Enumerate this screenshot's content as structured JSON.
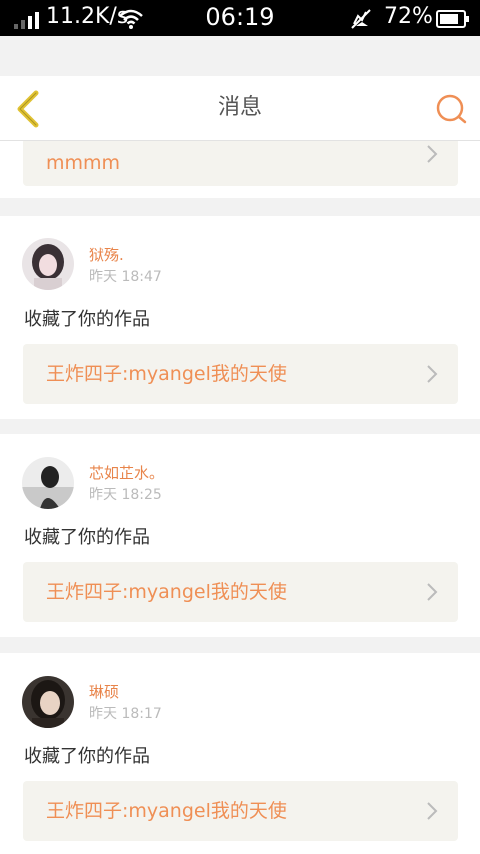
{
  "status_bar": {
    "net_speed": "11.2K/s",
    "time": "06:19",
    "battery_percent": "72%"
  },
  "header": {
    "title": "消息"
  },
  "colors": {
    "accent": "#ef8f55",
    "back_arrow": "#e0c233",
    "work_box_bg": "#f4f3ee"
  },
  "partial_item": {
    "work_title": "mmmm"
  },
  "messages": [
    {
      "user": "狱殇.",
      "time": "昨天 18:47",
      "action": "收藏了你的作品",
      "work_title": "王炸四子:myangel我的天使"
    },
    {
      "user": "芯如芷水。",
      "time": "昨天 18:25",
      "action": "收藏了你的作品",
      "work_title": "王炸四子:myangel我的天使"
    },
    {
      "user": "琳硕",
      "time": "昨天 18:17",
      "action": "收藏了你的作品",
      "work_title": "王炸四子:myangel我的天使"
    }
  ]
}
